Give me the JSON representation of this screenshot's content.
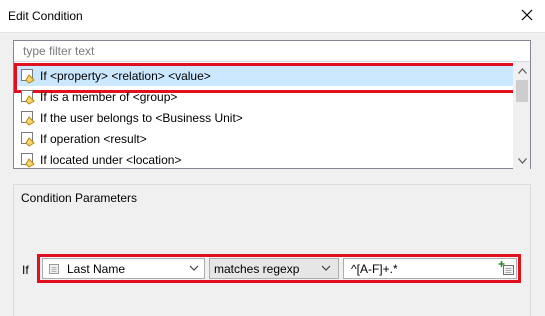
{
  "window": {
    "title": "Edit Condition"
  },
  "filter": {
    "placeholder": "type filter text"
  },
  "conditions": [
    {
      "label": "If <property> <relation> <value>",
      "selected": true
    },
    {
      "label": "If is a member of <group>",
      "selected": false
    },
    {
      "label": "If the user belongs to <Business Unit>",
      "selected": false
    },
    {
      "label": "If operation <result>",
      "selected": false
    },
    {
      "label": "If located under <location>",
      "selected": false
    }
  ],
  "parameters": {
    "legend": "Condition Parameters",
    "if_label": "If",
    "property_value": "Last Name",
    "relation_value": "matches regexp",
    "value_text": "^[A-F]+.*"
  },
  "icons": {
    "close": "close-icon",
    "condition": "condition-icon",
    "property": "property-icon",
    "dropdown": "chevron-down-icon",
    "value_picker": "value-picker-icon"
  },
  "colors": {
    "selection": "#cce8ff",
    "highlight": "#e0101e",
    "condition_icon": "#b8860b"
  }
}
